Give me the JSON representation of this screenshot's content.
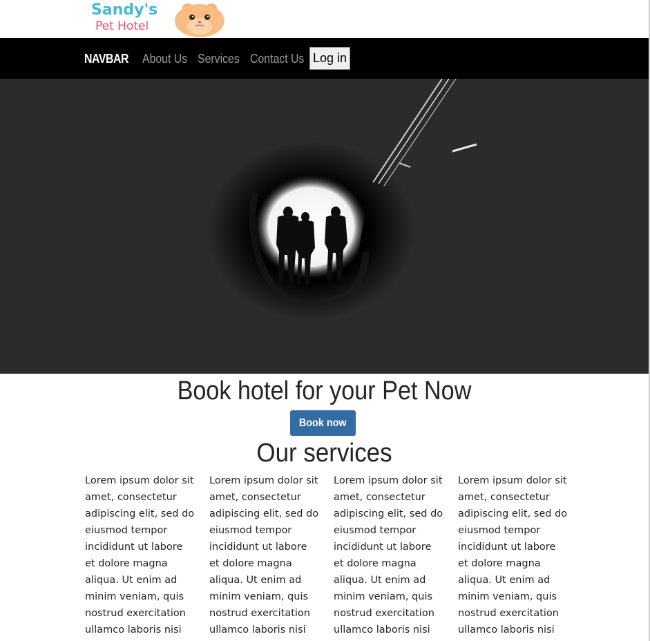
{
  "logo": {
    "line1": "Sandy's",
    "line2": "Pet Hotel",
    "mascot": "hamster-face-icon"
  },
  "navbar": {
    "brand": "NAVBAR",
    "links": [
      "About Us",
      "Services",
      "Contact Us"
    ],
    "login_label": "Log in"
  },
  "hero": {
    "image": "people-walking-out-of-cave-photo"
  },
  "main": {
    "headline": "Book hotel for your Pet Now",
    "book_label": "Book now",
    "services_title": "Our services",
    "columns": [
      "Lorem ipsum dolor sit amet, consectetur adipiscing elit, sed do eiusmod tempor incididunt ut labore et dolore magna aliqua. Ut enim ad minim veniam, quis nostrud exercitation ullamco laboris nisi",
      "Lorem ipsum dolor sit amet, consectetur adipiscing elit, sed do eiusmod tempor incididunt ut labore et dolore magna aliqua. Ut enim ad minim veniam, quis nostrud exercitation ullamco laboris nisi",
      "Lorem ipsum dolor sit amet, consectetur adipiscing elit, sed do eiusmod tempor incididunt ut labore et dolore magna aliqua. Ut enim ad minim veniam, quis nostrud exercitation ullamco laboris nisi",
      "Lorem ipsum dolor sit amet, consectetur adipiscing elit, sed do eiusmod tempor incididunt ut labore et dolore magna aliqua. Ut enim ad minim veniam, quis nostrud exercitation ullamco laboris nisi"
    ]
  },
  "colors": {
    "navbar_bg": "#000000",
    "hero_bg": "#2b2b2b",
    "button_bg": "#336ca3",
    "logo_blue": "#45b8d8",
    "logo_pink": "#e8506e"
  }
}
